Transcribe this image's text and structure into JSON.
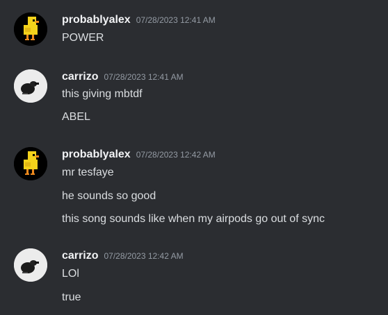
{
  "messages": [
    {
      "author": "probablyalex",
      "avatar": "duck-avatar",
      "timestamp": "07/28/2023 12:41 AM",
      "lines": [
        "POWER"
      ]
    },
    {
      "author": "carrizo",
      "avatar": "bird-photo-avatar",
      "timestamp": "07/28/2023 12:41 AM",
      "lines": [
        "this giving mbtdf",
        "ABEL"
      ]
    },
    {
      "author": "probablyalex",
      "avatar": "duck-avatar",
      "timestamp": "07/28/2023 12:42 AM",
      "lines": [
        "mr tesfaye",
        "he sounds so good",
        "this song sounds like when my airpods go out of sync"
      ]
    },
    {
      "author": "carrizo",
      "avatar": "bird-photo-avatar",
      "timestamp": "07/28/2023 12:42 AM",
      "lines": [
        "LOl",
        "true"
      ]
    }
  ],
  "colors": {
    "background": "#2b2d31",
    "username": "#f2f3f5",
    "timestamp": "#949ba4",
    "message_text": "#dbdee1"
  }
}
